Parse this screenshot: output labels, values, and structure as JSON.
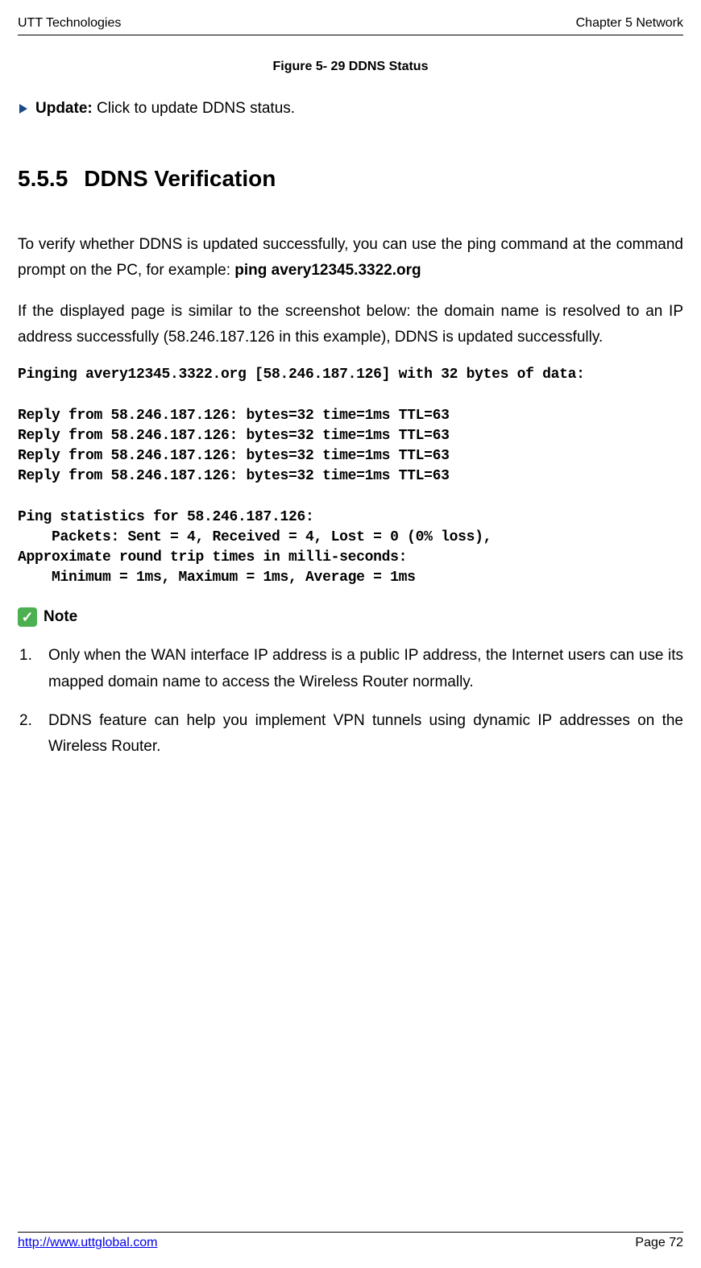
{
  "header": {
    "left": "UTT Technologies",
    "right": "Chapter 5 Network"
  },
  "figure_caption": "Figure 5- 29 DDNS Status",
  "update": {
    "label": "Update:",
    "text": "Click to update DDNS status."
  },
  "section": {
    "number": "5.5.5",
    "title": "DDNS Verification"
  },
  "para1_a": "To verify whether DDNS is updated successfully, you can use the ping command at the command prompt on the PC, for example: ",
  "para1_b": "ping avery12345.3322.org",
  "para2": "If the displayed page is similar to the screenshot below: the domain name is resolved to an IP address successfully (58.246.187.126 in this example), DDNS is updated successfully.",
  "ping_output": "Pinging avery12345.3322.org [58.246.187.126] with 32 bytes of data:\n\nReply from 58.246.187.126: bytes=32 time=1ms TTL=63\nReply from 58.246.187.126: bytes=32 time=1ms TTL=63\nReply from 58.246.187.126: bytes=32 time=1ms TTL=63\nReply from 58.246.187.126: bytes=32 time=1ms TTL=63\n\nPing statistics for 58.246.187.126:\n    Packets: Sent = 4, Received = 4, Lost = 0 (0% loss),\nApproximate round trip times in milli-seconds:\n    Minimum = 1ms, Maximum = 1ms, Average = 1ms",
  "note_label": "Note",
  "notes": {
    "item1_num": "1.",
    "item1_text": "Only when the WAN interface IP address is a public IP address, the Internet users can use its mapped domain name to access the Wireless Router normally.",
    "item2_num": "2.",
    "item2_text": "DDNS feature can help you implement VPN tunnels using dynamic IP addresses on the Wireless Router."
  },
  "footer": {
    "link": "http://www.uttglobal.com",
    "page": "Page 72"
  }
}
